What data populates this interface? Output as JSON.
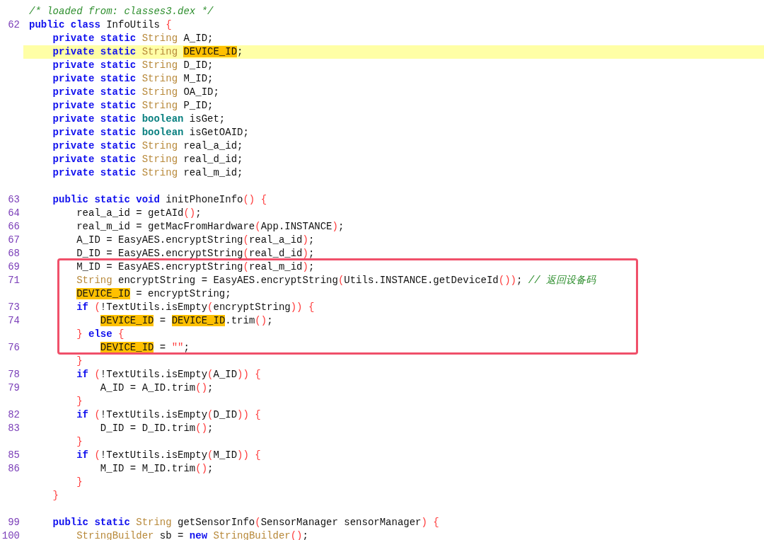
{
  "lines": [
    {
      "tokens": [
        {
          "kind": "comment",
          "text": "/* loaded from: classes3.dex */"
        }
      ],
      "selected": false,
      "boxed": false
    },
    {
      "number": "62",
      "tokens": [
        {
          "kind": "keyword",
          "text": "public class "
        },
        {
          "kind": "plain",
          "text": "InfoUtils "
        },
        {
          "kind": "punct",
          "text": "{"
        }
      ],
      "selected": false,
      "boxed": false
    },
    {
      "tokens": [
        {
          "kind": "keyword",
          "text": "    private static "
        },
        {
          "kind": "type",
          "text": "String "
        },
        {
          "kind": "plain",
          "text": "A_ID;"
        }
      ],
      "selected": false,
      "boxed": false
    },
    {
      "tokens": [
        {
          "kind": "keyword",
          "text": "    private static "
        },
        {
          "kind": "type",
          "text": "String "
        },
        {
          "kind": "match",
          "text": "DEVICE_ID"
        },
        {
          "kind": "plain",
          "text": ";"
        }
      ],
      "selected": true,
      "boxed": false
    },
    {
      "tokens": [
        {
          "kind": "keyword",
          "text": "    private static "
        },
        {
          "kind": "type",
          "text": "String "
        },
        {
          "kind": "plain",
          "text": "D_ID;"
        }
      ],
      "selected": false,
      "boxed": false
    },
    {
      "tokens": [
        {
          "kind": "keyword",
          "text": "    private static "
        },
        {
          "kind": "type",
          "text": "String "
        },
        {
          "kind": "plain",
          "text": "M_ID;"
        }
      ],
      "selected": false,
      "boxed": false
    },
    {
      "tokens": [
        {
          "kind": "keyword",
          "text": "    private static "
        },
        {
          "kind": "type",
          "text": "String "
        },
        {
          "kind": "plain",
          "text": "OA_ID;"
        }
      ],
      "selected": false,
      "boxed": false
    },
    {
      "tokens": [
        {
          "kind": "keyword",
          "text": "    private static "
        },
        {
          "kind": "type",
          "text": "String "
        },
        {
          "kind": "plain",
          "text": "P_ID;"
        }
      ],
      "selected": false,
      "boxed": false
    },
    {
      "tokens": [
        {
          "kind": "keyword",
          "text": "    private static "
        },
        {
          "kind": "primitive",
          "text": "boolean "
        },
        {
          "kind": "plain",
          "text": "isGet;"
        }
      ],
      "selected": false,
      "boxed": false
    },
    {
      "tokens": [
        {
          "kind": "keyword",
          "text": "    private static "
        },
        {
          "kind": "primitive",
          "text": "boolean "
        },
        {
          "kind": "plain",
          "text": "isGetOAID;"
        }
      ],
      "selected": false,
      "boxed": false
    },
    {
      "tokens": [
        {
          "kind": "keyword",
          "text": "    private static "
        },
        {
          "kind": "type",
          "text": "String "
        },
        {
          "kind": "plain",
          "text": "real_a_id;"
        }
      ],
      "selected": false,
      "boxed": false
    },
    {
      "tokens": [
        {
          "kind": "keyword",
          "text": "    private static "
        },
        {
          "kind": "type",
          "text": "String "
        },
        {
          "kind": "plain",
          "text": "real_d_id;"
        }
      ],
      "selected": false,
      "boxed": false
    },
    {
      "tokens": [
        {
          "kind": "keyword",
          "text": "    private static "
        },
        {
          "kind": "type",
          "text": "String "
        },
        {
          "kind": "plain",
          "text": "real_m_id;"
        }
      ],
      "selected": false,
      "boxed": false
    },
    {
      "number": "63",
      "space_before": true,
      "tokens": [
        {
          "kind": "keyword",
          "text": "    public static void "
        },
        {
          "kind": "plain",
          "text": "initPhoneInfo"
        },
        {
          "kind": "punct",
          "text": "() {"
        }
      ],
      "selected": false,
      "boxed": false
    },
    {
      "number": "64",
      "tokens": [
        {
          "kind": "plain",
          "text": "        real_a_id = getAId"
        },
        {
          "kind": "punct",
          "text": "()"
        },
        {
          "kind": "plain",
          "text": ";"
        }
      ],
      "selected": false,
      "boxed": false
    },
    {
      "number": "66",
      "tokens": [
        {
          "kind": "plain",
          "text": "        real_m_id = getMacFromHardware"
        },
        {
          "kind": "punct",
          "text": "("
        },
        {
          "kind": "plain",
          "text": "App.INSTANCE"
        },
        {
          "kind": "punct",
          "text": ")"
        },
        {
          "kind": "plain",
          "text": ";"
        }
      ],
      "selected": false,
      "boxed": false
    },
    {
      "number": "67",
      "tokens": [
        {
          "kind": "plain",
          "text": "        A_ID = EasyAES.encryptString"
        },
        {
          "kind": "punct",
          "text": "("
        },
        {
          "kind": "plain",
          "text": "real_a_id"
        },
        {
          "kind": "punct",
          "text": ")"
        },
        {
          "kind": "plain",
          "text": ";"
        }
      ],
      "selected": false,
      "boxed": false
    },
    {
      "number": "68",
      "tokens": [
        {
          "kind": "plain",
          "text": "        D_ID = EasyAES.encryptString"
        },
        {
          "kind": "punct",
          "text": "("
        },
        {
          "kind": "plain",
          "text": "real_d_id"
        },
        {
          "kind": "punct",
          "text": ")"
        },
        {
          "kind": "plain",
          "text": ";"
        }
      ],
      "selected": false,
      "boxed": false
    },
    {
      "number": "69",
      "tokens": [
        {
          "kind": "plain",
          "text": "        M_ID = EasyAES.encryptString"
        },
        {
          "kind": "punct",
          "text": "("
        },
        {
          "kind": "plain",
          "text": "real_m_id"
        },
        {
          "kind": "punct",
          "text": ")"
        },
        {
          "kind": "plain",
          "text": ";"
        }
      ],
      "selected": false,
      "boxed": true
    },
    {
      "number": "71",
      "tokens": [
        {
          "kind": "type",
          "text": "        String "
        },
        {
          "kind": "plain",
          "text": "encryptString = EasyAES.encryptString"
        },
        {
          "kind": "punct",
          "text": "("
        },
        {
          "kind": "plain",
          "text": "Utils.INSTANCE.getDeviceId"
        },
        {
          "kind": "punct",
          "text": "())"
        },
        {
          "kind": "plain",
          "text": "; "
        },
        {
          "kind": "comment",
          "text": "// 返回设备码"
        }
      ],
      "selected": false,
      "boxed": true
    },
    {
      "tokens": [
        {
          "kind": "match",
          "text": "        DEVICE_ID"
        },
        {
          "kind": "plain",
          "text": " = encryptString;"
        }
      ],
      "selected": false,
      "boxed": true
    },
    {
      "number": "73",
      "tokens": [
        {
          "kind": "keyword",
          "text": "        if "
        },
        {
          "kind": "punct",
          "text": "("
        },
        {
          "kind": "plain",
          "text": "!TextUtils.isEmpty"
        },
        {
          "kind": "punct",
          "text": "("
        },
        {
          "kind": "plain",
          "text": "encryptString"
        },
        {
          "kind": "punct",
          "text": ")) {"
        }
      ],
      "selected": false,
      "boxed": true
    },
    {
      "number": "74",
      "tokens": [
        {
          "kind": "match",
          "text": "            DEVICE_ID"
        },
        {
          "kind": "plain",
          "text": " = "
        },
        {
          "kind": "match",
          "text": "DEVICE_ID"
        },
        {
          "kind": "plain",
          "text": ".trim"
        },
        {
          "kind": "punct",
          "text": "()"
        },
        {
          "kind": "plain",
          "text": ";"
        }
      ],
      "selected": false,
      "boxed": true
    },
    {
      "tokens": [
        {
          "kind": "punct",
          "text": "        } "
        },
        {
          "kind": "keyword",
          "text": "else "
        },
        {
          "kind": "punct",
          "text": "{"
        }
      ],
      "selected": false,
      "boxed": true
    },
    {
      "number": "76",
      "tokens": [
        {
          "kind": "match",
          "text": "            DEVICE_ID"
        },
        {
          "kind": "plain",
          "text": " = "
        },
        {
          "kind": "punct",
          "text": "\"\""
        },
        {
          "kind": "plain",
          "text": ";"
        }
      ],
      "selected": false,
      "boxed": true
    },
    {
      "tokens": [
        {
          "kind": "punct",
          "text": "        }"
        }
      ],
      "selected": false,
      "boxed": false
    },
    {
      "number": "78",
      "tokens": [
        {
          "kind": "keyword",
          "text": "        if "
        },
        {
          "kind": "punct",
          "text": "("
        },
        {
          "kind": "plain",
          "text": "!TextUtils.isEmpty"
        },
        {
          "kind": "punct",
          "text": "("
        },
        {
          "kind": "plain",
          "text": "A_ID"
        },
        {
          "kind": "punct",
          "text": ")) {"
        }
      ],
      "selected": false,
      "boxed": false
    },
    {
      "number": "79",
      "tokens": [
        {
          "kind": "plain",
          "text": "            A_ID = A_ID.trim"
        },
        {
          "kind": "punct",
          "text": "()"
        },
        {
          "kind": "plain",
          "text": ";"
        }
      ],
      "selected": false,
      "boxed": false
    },
    {
      "tokens": [
        {
          "kind": "punct",
          "text": "        }"
        }
      ],
      "selected": false,
      "boxed": false
    },
    {
      "number": "82",
      "tokens": [
        {
          "kind": "keyword",
          "text": "        if "
        },
        {
          "kind": "punct",
          "text": "("
        },
        {
          "kind": "plain",
          "text": "!TextUtils.isEmpty"
        },
        {
          "kind": "punct",
          "text": "("
        },
        {
          "kind": "plain",
          "text": "D_ID"
        },
        {
          "kind": "punct",
          "text": ")) {"
        }
      ],
      "selected": false,
      "boxed": false
    },
    {
      "number": "83",
      "tokens": [
        {
          "kind": "plain",
          "text": "            D_ID = D_ID.trim"
        },
        {
          "kind": "punct",
          "text": "()"
        },
        {
          "kind": "plain",
          "text": ";"
        }
      ],
      "selected": false,
      "boxed": false
    },
    {
      "tokens": [
        {
          "kind": "punct",
          "text": "        }"
        }
      ],
      "selected": false,
      "boxed": false
    },
    {
      "number": "85",
      "tokens": [
        {
          "kind": "keyword",
          "text": "        if "
        },
        {
          "kind": "punct",
          "text": "("
        },
        {
          "kind": "plain",
          "text": "!TextUtils.isEmpty"
        },
        {
          "kind": "punct",
          "text": "("
        },
        {
          "kind": "plain",
          "text": "M_ID"
        },
        {
          "kind": "punct",
          "text": ")) {"
        }
      ],
      "selected": false,
      "boxed": false
    },
    {
      "number": "86",
      "tokens": [
        {
          "kind": "plain",
          "text": "            M_ID = M_ID.trim"
        },
        {
          "kind": "punct",
          "text": "()"
        },
        {
          "kind": "plain",
          "text": ";"
        }
      ],
      "selected": false,
      "boxed": false
    },
    {
      "tokens": [
        {
          "kind": "punct",
          "text": "        }"
        }
      ],
      "selected": false,
      "boxed": false
    },
    {
      "tokens": [
        {
          "kind": "punct",
          "text": "    }"
        }
      ],
      "selected": false,
      "boxed": false
    },
    {
      "number": "99",
      "space_before": true,
      "tokens": [
        {
          "kind": "keyword",
          "text": "    public static "
        },
        {
          "kind": "type",
          "text": "String "
        },
        {
          "kind": "plain",
          "text": "getSensorInfo"
        },
        {
          "kind": "punct",
          "text": "("
        },
        {
          "kind": "plain",
          "text": "SensorManager sensorManager"
        },
        {
          "kind": "punct",
          "text": ") {"
        }
      ],
      "selected": false,
      "boxed": false
    },
    {
      "number": "100",
      "tokens": [
        {
          "kind": "type",
          "text": "        StringBuilder "
        },
        {
          "kind": "plain",
          "text": "sb = "
        },
        {
          "kind": "keyword",
          "text": "new "
        },
        {
          "kind": "type",
          "text": "StringBuilder"
        },
        {
          "kind": "punct",
          "text": "()"
        },
        {
          "kind": "plain",
          "text": ";"
        }
      ],
      "selected": false,
      "boxed": false
    }
  ]
}
